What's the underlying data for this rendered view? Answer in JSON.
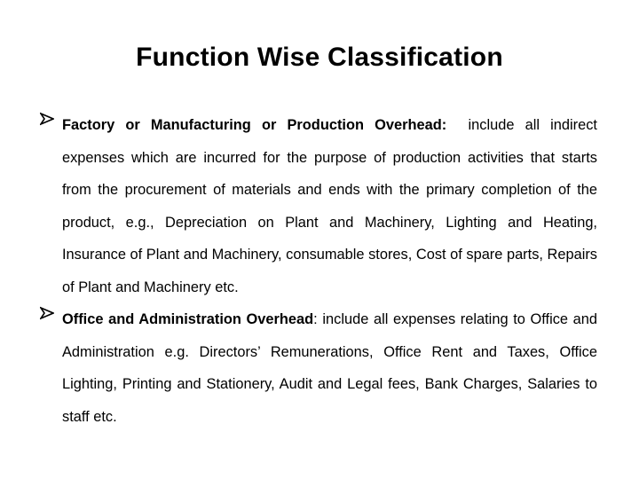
{
  "slide": {
    "title": "Function Wise Classification",
    "bullet_icon": "arrowhead-bullet",
    "bullets": [
      {
        "heading": "Factory or Manufacturing or Production Overhead",
        "separator": ":  ",
        "text": "include all indirect expenses which are incurred for the purpose of production activities that starts from the procurement of materials and ends with the primary completion of the product, e.g., Depreciation on Plant and Machinery, Lighting and Heating, Insurance of Plant and Machinery, consumable stores, Cost of spare parts, Repairs of Plant and Machinery etc."
      },
      {
        "heading": "Office and Administration Overhead",
        "separator": ": ",
        "text": "include all expenses relating to Office and Administration e.g. Directors’ Remunerations, Office Rent and Taxes, Office Lighting, Printing and Stationery, Audit and Legal fees, Bank Charges, Salaries to staff etc."
      }
    ]
  }
}
